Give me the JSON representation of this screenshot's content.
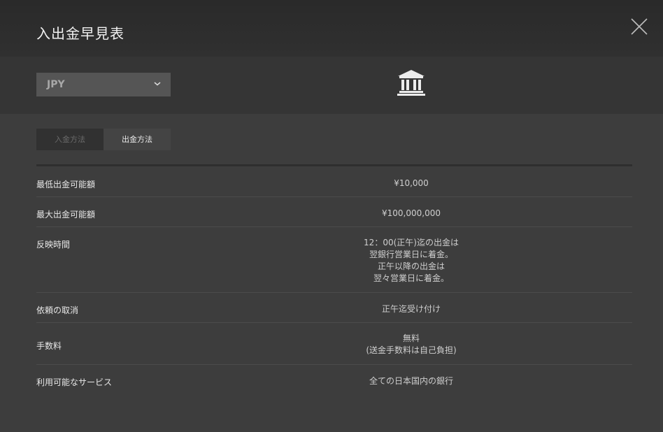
{
  "header": {
    "title": "入出金早見表"
  },
  "toolbar": {
    "currency": "JPY"
  },
  "tabs": [
    {
      "label": "入金方法",
      "active": false
    },
    {
      "label": "出金方法",
      "active": true
    }
  ],
  "rows": [
    {
      "label": "最低出金可能額",
      "lines": [
        "¥10,000"
      ]
    },
    {
      "label": "最大出金可能額",
      "lines": [
        "¥100,000,000"
      ]
    },
    {
      "label": "反映時間",
      "lines": [
        "12：00(正午)迄の出金は",
        "翌銀行営業日に着金。",
        "正午以降の出金は",
        "翌々営業日に着金。"
      ]
    },
    {
      "label": "依頼の取消",
      "lines": [
        "正午迄受け付け"
      ]
    },
    {
      "label": "手数料",
      "lines": [
        "無料",
        "(送金手数料は自己負担)"
      ]
    },
    {
      "label": "利用可能なサービス",
      "lines": [
        "全ての日本国内の銀行"
      ]
    }
  ],
  "colors": {
    "header_bg": "#2e2e2e",
    "toolbar_bg": "#353535",
    "content_bg": "#3d3d3d",
    "select_bg": "#555555"
  },
  "icons": {
    "close": "close-icon",
    "dropdown": "chevron-down-icon",
    "bank": "bank-icon"
  }
}
